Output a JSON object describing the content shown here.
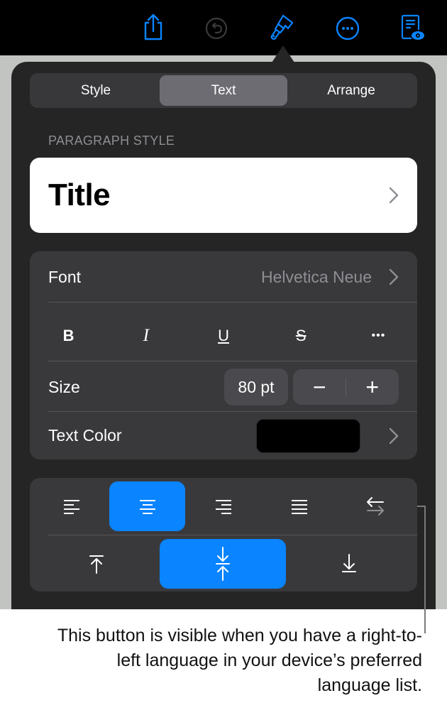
{
  "toolbar": {
    "icons": [
      {
        "name": "share-icon",
        "color": "#0a84ff"
      },
      {
        "name": "undo-icon",
        "color": "#3a3a3c"
      },
      {
        "name": "format-brush-icon",
        "color": "#0a84ff"
      },
      {
        "name": "more-icon",
        "color": "#0a84ff"
      },
      {
        "name": "reading-view-icon",
        "color": "#0a84ff"
      }
    ]
  },
  "tabs": [
    {
      "label": "Style",
      "active": false
    },
    {
      "label": "Text",
      "active": true
    },
    {
      "label": "Arrange",
      "active": false
    }
  ],
  "paragraph_style": {
    "section_label": "PARAGRAPH STYLE",
    "value": "Title"
  },
  "font": {
    "label": "Font",
    "value": "Helvetica Neue"
  },
  "style_buttons": [
    {
      "label": "B",
      "name": "bold"
    },
    {
      "label": "I",
      "name": "italic"
    },
    {
      "label": "U",
      "name": "underline"
    },
    {
      "label": "S",
      "name": "strikethrough"
    },
    {
      "label": "•••",
      "name": "more-text-options"
    }
  ],
  "size": {
    "label": "Size",
    "value": "80 pt",
    "decrement": "−",
    "increment": "+"
  },
  "text_color": {
    "label": "Text Color",
    "swatch": "#000000"
  },
  "alignment": {
    "horizontal": [
      "left",
      "center",
      "right",
      "justify",
      "rtl-direction"
    ],
    "horizontal_selected": "center",
    "vertical": [
      "top",
      "middle",
      "bottom"
    ],
    "vertical_selected": "middle"
  },
  "accent_color": "#0a84ff",
  "caption": "This button is visible when you have a right-to-left language in your device’s preferred language list."
}
